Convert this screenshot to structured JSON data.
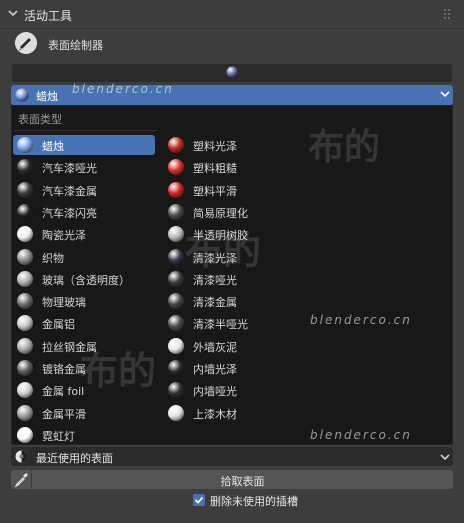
{
  "header": {
    "title": "活动工具"
  },
  "tool": {
    "label": "表面绘制器"
  },
  "dropdown": {
    "selected": "蜡烛"
  },
  "popup": {
    "section_title": "表面类型",
    "left_column": [
      {
        "label": "蜡烛",
        "color": "#7aa2e8",
        "selected": true
      },
      {
        "label": "汽车漆哑光",
        "color": "#2a2a2a"
      },
      {
        "label": "汽车漆金属",
        "color": "#3a3a3a"
      },
      {
        "label": "汽车漆闪亮",
        "color": "#1e1e1e"
      },
      {
        "label": "陶瓷光泽",
        "color": "#f0f0f0"
      },
      {
        "label": "织物",
        "color": "#8a8a8a"
      },
      {
        "label": "玻璃（含透明度）",
        "color": "#b0b0b0"
      },
      {
        "label": "物理玻璃",
        "color": "#6a6a6a"
      },
      {
        "label": "金属铝",
        "color": "#c8c8c8"
      },
      {
        "label": "拉丝钢金属",
        "color": "#a8a8a8"
      },
      {
        "label": "镀铬金属",
        "color": "#5a5a5a"
      },
      {
        "label": "金属 foil",
        "color": "#d0d0d0"
      },
      {
        "label": "金属平滑",
        "color": "#9a9a9a"
      },
      {
        "label": "霓虹灯",
        "color": "#ffffff"
      }
    ],
    "right_column": [
      {
        "label": "塑料光泽",
        "color": "#c0281e"
      },
      {
        "label": "塑料粗糙",
        "color": "#d8322a"
      },
      {
        "label": "塑料平滑",
        "color": "#d42020"
      },
      {
        "label": "简易原理化",
        "color": "#4a4a4a"
      },
      {
        "label": "半透明树胶",
        "color": "#b8b8b8"
      },
      {
        "label": "清漆光泽",
        "color": "#333344"
      },
      {
        "label": "清漆哑光",
        "color": "#3a3a3a"
      },
      {
        "label": "清漆金属",
        "color": "#444444"
      },
      {
        "label": "清漆半哑光",
        "color": "#4a4a4a"
      },
      {
        "label": "外墙灰泥",
        "color": "#e8e8e8"
      },
      {
        "label": "内墙光泽",
        "color": "#2a2a2a"
      },
      {
        "label": "内墙哑光",
        "color": "#303030"
      },
      {
        "label": "上漆木材",
        "color": "#e2e2e2"
      }
    ]
  },
  "watermarks": {
    "text": "布的",
    "url": "blenderco.cn"
  },
  "recent": {
    "label": "最近使用的表面"
  },
  "pick": {
    "label": "拾取表面"
  },
  "checkbox": {
    "label": "删除未使用的插槽",
    "checked": true
  }
}
